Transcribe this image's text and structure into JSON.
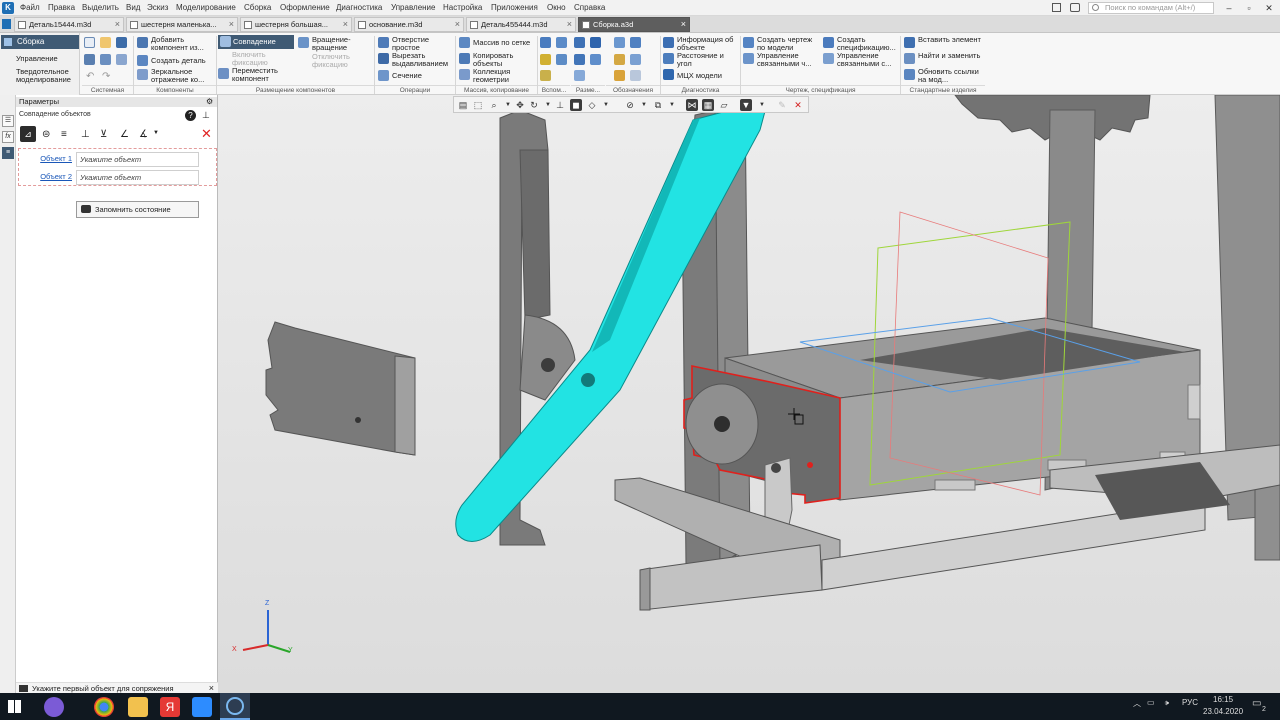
{
  "menubar": {
    "items": [
      "Файл",
      "Правка",
      "Выделить",
      "Вид",
      "Эскиз",
      "Моделирование",
      "Сборка",
      "Оформление",
      "Диагностика",
      "Управление",
      "Настройка",
      "Приложения",
      "Окно",
      "Справка"
    ],
    "search_placeholder": "Поиск по командам (Alt+/)"
  },
  "tabs": [
    {
      "label": "Деталь15444.m3d"
    },
    {
      "label": "шестерня маленька..."
    },
    {
      "label": "шестерня большая..."
    },
    {
      "label": "основание.m3d"
    },
    {
      "label": "Деталь455444.m3d"
    },
    {
      "label": "Сборка.a3d",
      "active": true
    }
  ],
  "ribbon": {
    "side": {
      "active": "Сборка",
      "items": [
        "Управление",
        "Твердотельное моделирование"
      ]
    },
    "components": {
      "add": "Добавить компонент из...",
      "create": "Создать деталь",
      "mirror": "Зеркальное отражение ко..."
    },
    "placement": {
      "coincidence": "Совпадение",
      "rotation": "Вращение-вращение",
      "fix": "Включить фиксацию",
      "unfix": "Отключить фиксацию",
      "move": "Переместить компонент"
    },
    "operations": {
      "hole": "Отверстие простое",
      "extrude_cut": "Вырезать выдавливанием",
      "section": "Сечение"
    },
    "arrays": {
      "grid": "Массив по сетке",
      "copy": "Копировать объекты",
      "collection": "Коллекция геометрии"
    },
    "diagnostics": {
      "info": "Информация об объекте",
      "distance": "Расстояние и угол",
      "mass": "МЦХ модели"
    },
    "drawing": {
      "create_drawing": "Создать чертеж по модели",
      "create_spec": "Создать спецификацию...",
      "linked_drawings": "Управление связанными ч...",
      "linked_specs": "Управление связанными с..."
    },
    "standard": {
      "insert": "Вставить элемент",
      "find_replace": "Найти и заменить",
      "update": "Обновить ссылки на мод..."
    },
    "groups": [
      "Системная",
      "Компоненты",
      "Размещение компонентов",
      "Операции",
      "Массив, копирование",
      "Вспом...",
      "Разме...",
      "Обозначения",
      "Диагностика",
      "Чертеж, спецификация",
      "Стандартные изделия"
    ]
  },
  "panel": {
    "title": "Параметры",
    "subtitle": "Совпадение объектов",
    "object1_label": "Объект 1",
    "object1_value": "Укажите объект",
    "object2_label": "Объект 2",
    "object2_value": "Укажите объект",
    "save_state": "Запомнить состояние",
    "status": "Укажите первый объект для сопряжения"
  },
  "taskbar": {
    "lang": "РУС",
    "time": "16:15",
    "date": "23.04.2020",
    "notif": "2"
  },
  "colors": {
    "accent": "#3f5a74",
    "model_gray": "#6f6f6f",
    "cyan": "#22e3e3",
    "highlight": "#e0201c"
  }
}
